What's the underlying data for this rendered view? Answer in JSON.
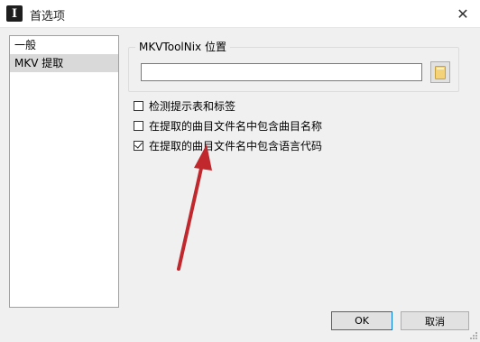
{
  "window": {
    "title": "首选项",
    "app_icon_glyph": "I",
    "close_glyph": "✕"
  },
  "sidebar": {
    "items": [
      {
        "label": "一般",
        "selected": false
      },
      {
        "label": "MKV 提取",
        "selected": true
      }
    ]
  },
  "mkvtoolnix": {
    "group_label": "MKVToolNix 位置",
    "path_value": "",
    "browse_icon": "folder-icon"
  },
  "options": [
    {
      "label": "检测提示表和标签",
      "checked": false
    },
    {
      "label": "在提取的曲目文件名中包含曲目名称",
      "checked": false
    },
    {
      "label": "在提取的曲目文件名中包含语言代码",
      "checked": true
    }
  ],
  "buttons": {
    "ok": "OK",
    "cancel": "取消"
  },
  "colors": {
    "arrow": "#c0282d",
    "focus_border": "#0078d7"
  }
}
